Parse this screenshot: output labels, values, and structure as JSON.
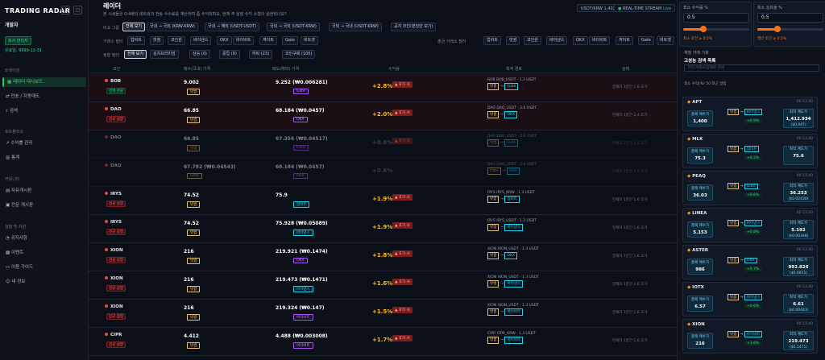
{
  "sidebar": {
    "brand": "TRADING RADAR",
    "user": "개발자",
    "role_badge": "회사 관리자",
    "expires": "유효일: 9999-12-31",
    "sections": [
      {
        "label": "트레이딩"
      },
      {
        "label": "포트폴리오"
      },
      {
        "label": "커뮤니티"
      },
      {
        "label": "설정 및 자원"
      }
    ],
    "items": [
      {
        "label": "레이더 대시보드",
        "icon": "grid-icon"
      },
      {
        "label": "전송 / 자동매도",
        "icon": "transfer-icon"
      },
      {
        "label": "검색",
        "icon": "search-icon"
      },
      {
        "label": "수익률 관리",
        "icon": "chart-icon"
      },
      {
        "label": "통계",
        "icon": "stats-icon"
      },
      {
        "label": "자유게시판",
        "icon": "board-icon"
      },
      {
        "label": "전문 게시판",
        "icon": "doc-icon"
      },
      {
        "label": "공지사항",
        "icon": "bell-icon"
      },
      {
        "label": "이벤트",
        "icon": "gift-icon"
      },
      {
        "label": "이용 가이드",
        "icon": "book-icon"
      },
      {
        "label": "내 정보",
        "icon": "user-icon"
      }
    ]
  },
  "header": {
    "title": "레이더",
    "description": "본 시세들은 0.4배의 네트워크 전송 수수료를 계산하여 좀 수익되며요, 현재 주 실질 수익 소형이 실현되나요?",
    "rate": "USDT/KRW 1,402",
    "status": "REAL-TIME STREAM",
    "status_live": "Live"
  },
  "filters": {
    "compare_label": "비교 그룹",
    "compare": [
      "전체 보기",
      "국내 → 국외 (KRW-KRW)",
      "국내 → 해외 (USDT-USDT)",
      "국외 → 국외 (USDT-KRW)",
      "국외 → 국내 (USDT-KRW)",
      "공지 코인(펀딩만 보기)"
    ],
    "exchange_label": "거래소 필터",
    "exchanges": [
      "업비트",
      "빗썸",
      "코인원",
      "바이낸스",
      "OKX",
      "바이비트",
      "게이트",
      "Gate",
      "비트겟"
    ],
    "exchange_label2": "출금 거래소 필터",
    "exchanges2": [
      "업비트",
      "빗썸",
      "코인원",
      "바이낸스",
      "OKX",
      "바이비트",
      "게이트",
      "Gate",
      "비트겟"
    ],
    "sort_label": "정렬 필터",
    "sorts": [
      "전체 보기",
      "김치프리미엄",
      "상승 (0)",
      "중립 (0)",
      "하락 (23)",
      "코인구매 (100)"
    ]
  },
  "table": {
    "headers": [
      "코인",
      "매수(국내) 가격",
      "매도(해외) 가격",
      "수익률",
      "최적 경로",
      "상태"
    ],
    "rows": [
      {
        "coin": "BOB",
        "tag": "전액 완료",
        "tag_type": "g",
        "buy": "9.002",
        "buy_ex": "빗썸",
        "sell": "9.252 (₩0.006281)",
        "sell_ex": "Gate",
        "pct": "+2.8%",
        "alert": "▲ 호가 사",
        "route": "BOB BOB_USDT · 1.3 USDT",
        "route_from": "빗썸",
        "route_to": "Gate",
        "note": "현재차 1분간 1.6 호가",
        "style": "red"
      },
      {
        "coin": "DAO",
        "tag": "신규 상장",
        "tag_type": "r",
        "buy": "66.85",
        "buy_ex": "빗썸",
        "sell": "68.184 (₩0.0457)",
        "sell_ex": "OKX",
        "pct": "+2.0%",
        "alert": "▲ 호가 사",
        "route": "DAO DAO_USDT · 2.6 USDT",
        "route_from": "빗썸",
        "route_to": "OKX",
        "note": "현재차 1분간 2.4 호가",
        "style": "red"
      },
      {
        "coin": "DAO",
        "tag": "",
        "tag_type": "r",
        "buy": "66.85",
        "buy_ex": "빗썸",
        "sell": "67.356 (₩0.04517)",
        "sell_ex": "Gate",
        "pct": "+0.8%",
        "alert": "▲ 호가 사",
        "route": "DAO DAO_USDT · 2.6 USDT",
        "route_from": "빗썸",
        "route_to": "Gate",
        "note": "현재차 1분간 2.4 호가",
        "style": "dim"
      },
      {
        "coin": "DAO",
        "tag": "",
        "tag_type": "r",
        "buy": "67.792 (₩0.04543)",
        "buy_ex": "Gate",
        "sell": "68.184 (₩0.0457)",
        "sell_ex": "OKX",
        "pct": "+0.6%",
        "alert": "",
        "route": "DAO DAO_USDT · 2.6 USDT",
        "route_from": "Gate",
        "route_to": "OKX",
        "note": "현재차 1분간 2.4 호가",
        "style": "dim"
      },
      {
        "coin": "IRYS",
        "tag": "신규 상장",
        "tag_type": "r",
        "buy": "74.52",
        "buy_ex": "빗썸",
        "sell": "75.9",
        "sell_ex": "업비트",
        "pct": "+1.9%",
        "alert": "▲ 호가 사",
        "route": "IRYS IRYS_KRW · 1.3 USDT",
        "route_from": "빗썸",
        "route_to": "업비트",
        "note": "현재차 1분간 1.6 호가",
        "style": ""
      },
      {
        "coin": "IRYS",
        "tag": "신규 상장",
        "tag_type": "r",
        "buy": "74.52",
        "buy_ex": "빗썸",
        "sell": "75.928 (₩0.05089)",
        "sell_ex": "바이낸스",
        "pct": "+1.9%",
        "alert": "▲ 호가 사",
        "route": "IRYS IRYS_USDT · 1.3 USDT",
        "route_from": "빗썸",
        "route_to": "바이낸스",
        "note": "현재차 1분간 1.6 호가",
        "style": ""
      },
      {
        "coin": "XION",
        "tag": "신규 상장",
        "tag_type": "r",
        "buy": "216",
        "buy_ex": "빗썸",
        "sell": "219.921 (₩0.1474)",
        "sell_ex": "OKX",
        "pct": "+1.8%",
        "alert": "▲ 호가 사",
        "route": "XION XION_USDT · 1.3 USDT",
        "route_from": "빗썸",
        "route_to": "OKX",
        "note": "현재차 1분간 1.6 호가",
        "style": ""
      },
      {
        "coin": "XION",
        "tag": "신규 상장",
        "tag_type": "r",
        "buy": "216",
        "buy_ex": "빗썸",
        "sell": "219.473 (₩0.1471)",
        "sell_ex": "바이낸스",
        "pct": "+1.6%",
        "alert": "▲ 호가 사",
        "route": "XION XION_USDT · 1.3 USDT",
        "route_from": "빗썸",
        "route_to": "바이낸스",
        "note": "현재차 1분간 1.6 호가",
        "style": ""
      },
      {
        "coin": "XION",
        "tag": "신규 상장",
        "tag_type": "r",
        "buy": "216",
        "buy_ex": "빗썸",
        "sell": "219.324 (₩0.147)",
        "sell_ex": "바이비트",
        "pct": "+1.5%",
        "alert": "▲ 호가 사",
        "route": "XION XION_USDT · 1.3 USDT",
        "route_from": "빗썸",
        "route_to": "바이비트",
        "note": "현재차 1분간 1.6 호가",
        "style": ""
      },
      {
        "coin": "CIPR",
        "tag": "신규 상장",
        "tag_type": "r",
        "buy": "4.412",
        "buy_ex": "빗썸",
        "sell": "4.488 (₩0.003008)",
        "sell_ex": "바이비트",
        "pct": "+1.7%",
        "alert": "▲ 호가 사",
        "route": "CIPR CIPR_KRW · 1.3 USDT",
        "route_from": "빗썸",
        "route_to": "바이비트",
        "note": "현재차 1분간 1.6 호가",
        "style": ""
      }
    ]
  },
  "settings": {
    "min_profit_label": "최소 수익률 %",
    "min_profit_value": "0.5",
    "min_profit_level_pct": 30,
    "min_profit_sub": "최소 조건 ≥ 0.5%",
    "min_volume_label": "최소 김프율 %",
    "min_volume_value": "0.5",
    "min_volume_level_pct": 30,
    "min_volume_sub": "필터 조건 ≥ 0.5%"
  },
  "panel": {
    "subtitle": "재정 거래 기회",
    "title": "고성능 검색 목록",
    "search_placeholder": "코인/거래소/상태로 검색",
    "controls": "최소 수익(%) 50   최근 알림",
    "cards": [
      {
        "coin": "APT",
        "time": "00:13:40",
        "a_label": "총매 매수가",
        "a_val": "1,400",
        "from": "빗썸",
        "to": "바이낸스",
        "gain": "+0.9%",
        "b_label": "최적 매도가",
        "b_val": "1,412.934",
        "b_sub": "($0.947)"
      },
      {
        "coin": "MLK",
        "time": "00:13:40",
        "a_label": "총매 매수가",
        "a_val": "75.3",
        "from": "빗썸",
        "to": "업비트",
        "gain": "+0.5%",
        "b_label": "최적 매도가",
        "b_val": "75.6",
        "b_sub": ""
      },
      {
        "coin": "PEAQ",
        "time": "00:13:40",
        "a_label": "총매 매수가",
        "a_val": "36.03",
        "from": "빗썸",
        "to": "Gate",
        "gain": "+0.6%",
        "b_label": "최적 매도가",
        "b_val": "36.253",
        "b_sub": "($0.02430)"
      },
      {
        "coin": "LINEA",
        "time": "00:13:40",
        "a_label": "총매 매수가",
        "a_val": "5.153",
        "from": "빗썸",
        "to": "바이낸스",
        "gain": "+0.8%",
        "b_label": "최적 매도가",
        "b_val": "5.192",
        "b_sub": "($0.00348)"
      },
      {
        "coin": "ASTER",
        "time": "00:13:40",
        "a_label": "총매 매수가",
        "a_val": "986",
        "from": "빗썸",
        "to": "OKX",
        "gain": "+0.7%",
        "b_label": "최적 매도가",
        "b_val": "992.826",
        "b_sub": "($0.6655)"
      },
      {
        "coin": "IOTX",
        "time": "00:13:40",
        "a_label": "총매 매수가",
        "a_val": "6.57",
        "from": "빗썸",
        "to": "바이낸스",
        "gain": "+0.6%",
        "b_label": "최적 매도가",
        "b_val": "6.61",
        "b_sub": "($0.00443)"
      },
      {
        "coin": "XION",
        "time": "00:13:40",
        "a_label": "총매 매수가",
        "a_val": "216",
        "from": "빗썸",
        "to": "바이비트",
        "gain": "+1.6%",
        "b_label": "최적 매도가",
        "b_val": "219.473",
        "b_sub": "($0.1471)"
      }
    ]
  }
}
